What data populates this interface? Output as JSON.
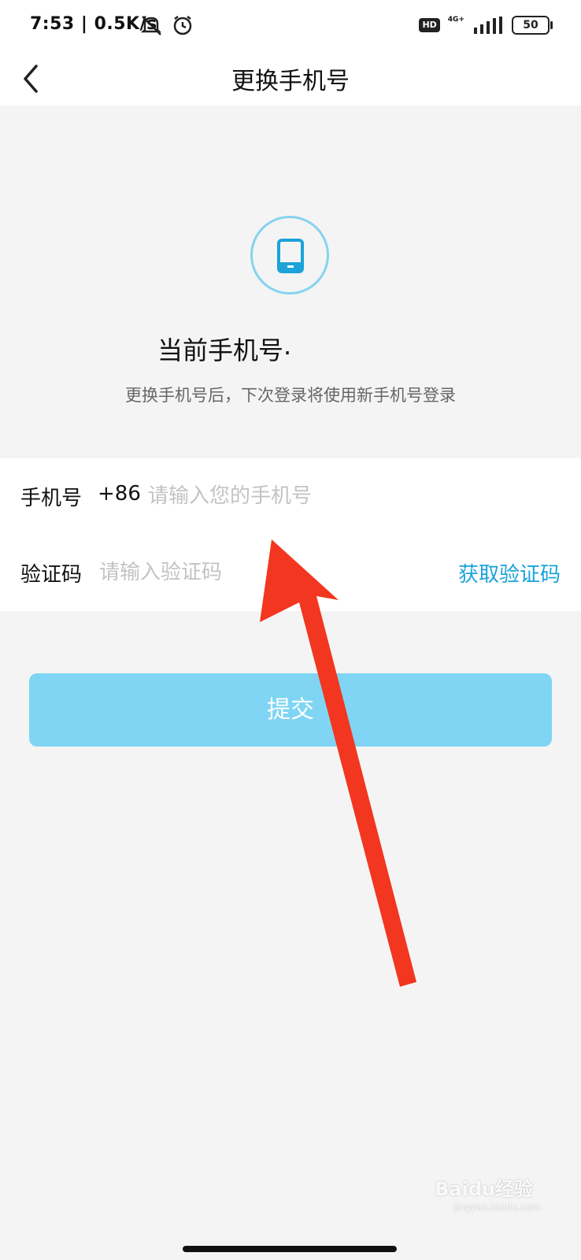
{
  "status_bar": {
    "time_speed": "7:53 | 0.5K/s",
    "hd": "HD",
    "network": "4G+",
    "battery": "50"
  },
  "header": {
    "title": "更换手机号"
  },
  "hero": {
    "current_label": "当前手机号",
    "current_value": ".",
    "hint": "更换手机号后，下次登录将使用新手机号登录"
  },
  "form": {
    "phone": {
      "label": "手机号",
      "country_code": "+86",
      "placeholder": "请输入您的手机号",
      "value": ""
    },
    "code": {
      "label": "验证码",
      "placeholder": "请输入验证码",
      "value": "",
      "get_code_label": "获取验证码"
    }
  },
  "submit_label": "提交",
  "watermark": {
    "text": "Baidu经验",
    "sub": "jingyan.baidu.com"
  },
  "colors": {
    "accent": "#1ba3da",
    "button": "#7fd5f3",
    "annotation_arrow": "#f2361f"
  },
  "icons": [
    "back-chevron-icon",
    "phone-icon",
    "mute-icon",
    "alarm-icon",
    "signal-icon",
    "battery-icon"
  ]
}
